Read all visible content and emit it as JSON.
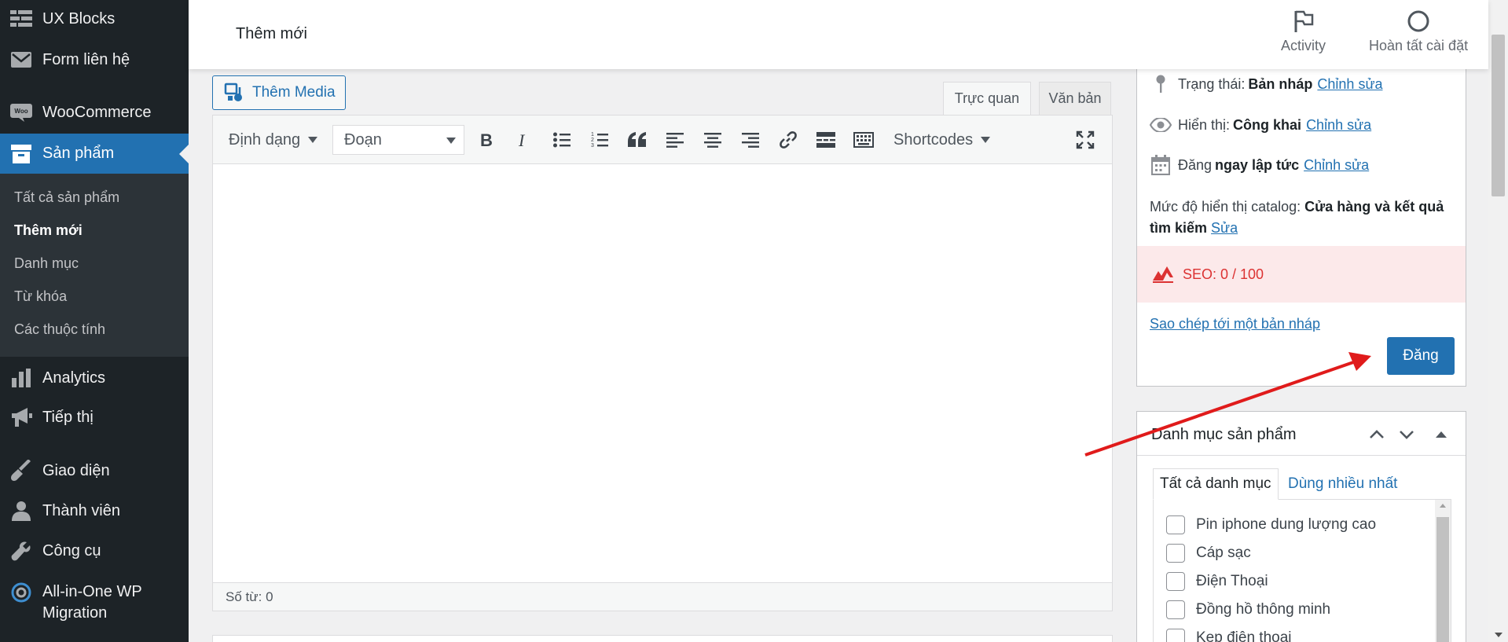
{
  "sidebar": {
    "items": [
      {
        "label": "UX Blocks",
        "icon": "grid-icon"
      },
      {
        "label": "Form liên hệ",
        "icon": "mail-icon"
      },
      {
        "label": "WooCommerce",
        "icon": "woocommerce-icon"
      },
      {
        "label": "Sản phẩm",
        "icon": "archive-icon"
      },
      {
        "label": "Analytics",
        "icon": "bar-chart-icon"
      },
      {
        "label": "Tiếp thị",
        "icon": "megaphone-icon"
      },
      {
        "label": "Giao diện",
        "icon": "brush-icon"
      },
      {
        "label": "Thành viên",
        "icon": "user-icon"
      },
      {
        "label": "Công cụ",
        "icon": "wrench-icon"
      },
      {
        "label_line1": "All-in-One WP",
        "label_line2": "Migration",
        "icon": "migration-icon"
      }
    ],
    "submenu": [
      "Tất cả sản phẩm",
      "Thêm mới",
      "Danh mục",
      "Từ khóa",
      "Các thuộc tính"
    ]
  },
  "header": {
    "title": "Thêm mới",
    "activity_label": "Activity",
    "setup_label": "Hoàn tất cài đặt"
  },
  "editor": {
    "add_media_label": "Thêm Media",
    "tab_visual": "Trực quan",
    "tab_text": "Văn bản",
    "format_label": "Định dạng",
    "paragraph_select": "Đoạn",
    "shortcodes_label": "Shortcodes",
    "word_count": "Số từ: 0"
  },
  "publish": {
    "status_prefix": "Trạng thái:",
    "status_value": "Bản nháp",
    "visibility_prefix": "Hiển thị:",
    "visibility_value": "Công khai",
    "edit_link": "Chỉnh sửa",
    "publish_prefix": "Đăng",
    "publish_value": "ngay lập tức",
    "catalog_prefix": "Mức độ hiển thị catalog:",
    "catalog_value": "Cửa hàng và kết quả tìm kiếm",
    "catalog_edit": "Sửa",
    "seo_label": "SEO: 0 / 100",
    "copy_draft": "Sao chép tới một bản nháp",
    "publish_button": "Đăng"
  },
  "categories": {
    "title": "Danh mục sản phẩm",
    "tab_all": "Tất cả danh mục",
    "tab_popular": "Dùng nhiều nhất",
    "items": [
      "Pin iphone dung lượng cao",
      "Cáp sạc",
      "Điện Thoại",
      "Đồng hồ thông minh",
      "Kẹp điện thoại"
    ]
  },
  "colors": {
    "sidebar_bg": "#1d2327",
    "accent": "#2271b1",
    "seo_bg": "#fce9ea",
    "seo_text": "#dc3232",
    "annotation_arrow": "#e01b1b"
  }
}
